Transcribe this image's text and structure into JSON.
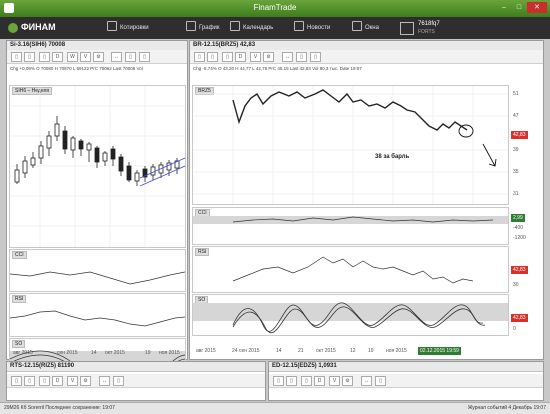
{
  "app": {
    "title": "FinamTrade",
    "logo_text": "ФИНАМ"
  },
  "toolbar": {
    "items": [
      {
        "label": "Котировки",
        "icon": "quotes-icon"
      },
      {
        "label": "График",
        "icon": "chart-icon"
      },
      {
        "label": "Календарь",
        "icon": "calendar-icon"
      },
      {
        "label": "Новости",
        "icon": "news-icon"
      },
      {
        "label": "Окна",
        "icon": "windows-icon"
      }
    ],
    "account": {
      "id": "7618fq7",
      "sub": "FORTS"
    }
  },
  "buttons": {
    "d": "D",
    "w": "W",
    "v": "V",
    "settings": "⚙"
  },
  "left_window": {
    "title": "Si-3.16(SIH6) 70008",
    "quote": "Chg +0,09%  O 70080  H 70870  L 69122  PrC 70062  Last 70008  Vol",
    "price_label": "SIH6 – Неделя",
    "ind1": "CCI",
    "ind2": "RSI",
    "ind3": "SO",
    "x_ticks": [
      "авг 2015",
      "сен 2015",
      "14",
      "окт 2015",
      "19",
      "ноя 2015"
    ]
  },
  "right_window": {
    "title": "BR-12.15(BRZ5) 42,83",
    "quote": "Chg -6,74%  O 43,20  H 44,77  L 42,78  PrC 45,15  Last 42,83  Vol 90,3 тыс.  Date 19:07",
    "price_label": "BRZ5",
    "annotation": "38 за барль",
    "price_ticks": [
      "51",
      "47",
      "42,83",
      "39",
      "35",
      "31"
    ],
    "price_tag": "42,83",
    "ind1": "CCI",
    "ind2": "RSI",
    "ind3": "SO",
    "cci_ticks": [
      "2,99",
      "-400",
      "-1200"
    ],
    "rsi_ticks": [
      "42,83",
      "30"
    ],
    "so_ticks": [
      "42,83",
      "0"
    ],
    "x_ticks": [
      "авг 2015",
      "24 сен 2015",
      "14",
      "21",
      "окт 2015",
      "12",
      "19",
      "ноя 2015",
      "16"
    ],
    "date_tag": "02.12.2015 19:59"
  },
  "bottom_left": {
    "title": "RTS-12.15(RIZ5) 81190"
  },
  "bottom_right": {
    "title": "ED-12.15(EDZ5) 1,0931"
  },
  "status": {
    "left": "29M26 Кб   Sorerril   Последнее сохранение: 19:07",
    "right": "Журнал событий   4 Декабрь 19:07"
  },
  "colors": {
    "green": "#3e7d1d",
    "red": "#d9302c",
    "darkbar": "#2e2e2e",
    "so_band": "#d6d6d6"
  }
}
